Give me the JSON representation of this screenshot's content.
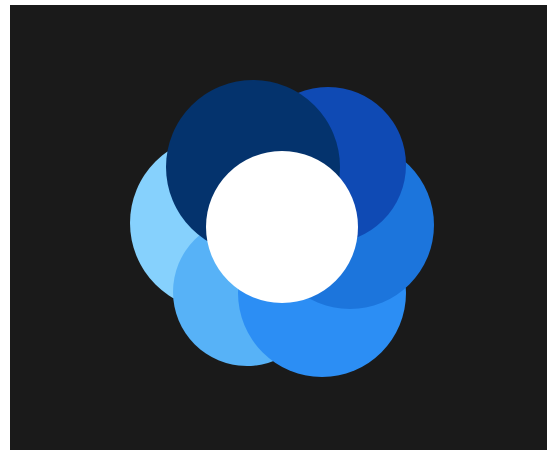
{
  "logo": {
    "name": "flower-logo",
    "colors": {
      "background": "#1a1a1a",
      "center": "#ffffff",
      "petal_top_left": "#04336d",
      "petal_top_right": "#0f4ab4",
      "petal_right": "#1c75dc",
      "petal_bottom_right": "#2c8ef4",
      "petal_bottom_left": "#57b2f7",
      "petal_left": "#86d1fd"
    }
  }
}
